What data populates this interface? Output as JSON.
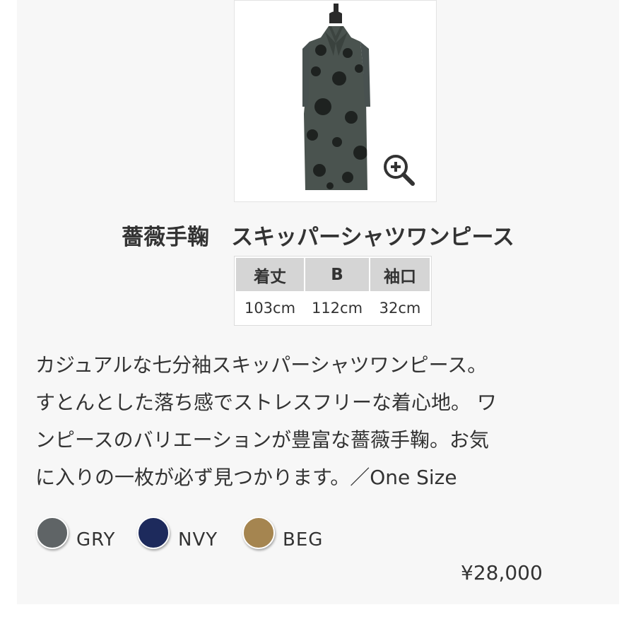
{
  "product": {
    "title": "薔薇手鞠　スキッパーシャツワンピース",
    "price": "¥28,000",
    "description_lines": [
      "カジュアルな七分袖スキッパーシャツワンピース。",
      "すとんとした落ち感でストレスフリーな着心地。 ワ",
      "ンピースのバリエーションが豊富な薔薇手鞠。お気",
      "に入りの一枚が必ず見つかります。／One Size"
    ],
    "image_zoom_icon": "zoom-in-icon"
  },
  "size_table": {
    "headers": [
      "着丈",
      "B",
      "袖口"
    ],
    "values": [
      "103cm",
      "112cm",
      "32cm"
    ]
  },
  "colors": [
    {
      "code": "GRY",
      "hex": "#5f6466"
    },
    {
      "code": "NVY",
      "hex": "#1d2a5c"
    },
    {
      "code": "BEG",
      "hex": "#a58550"
    }
  ]
}
